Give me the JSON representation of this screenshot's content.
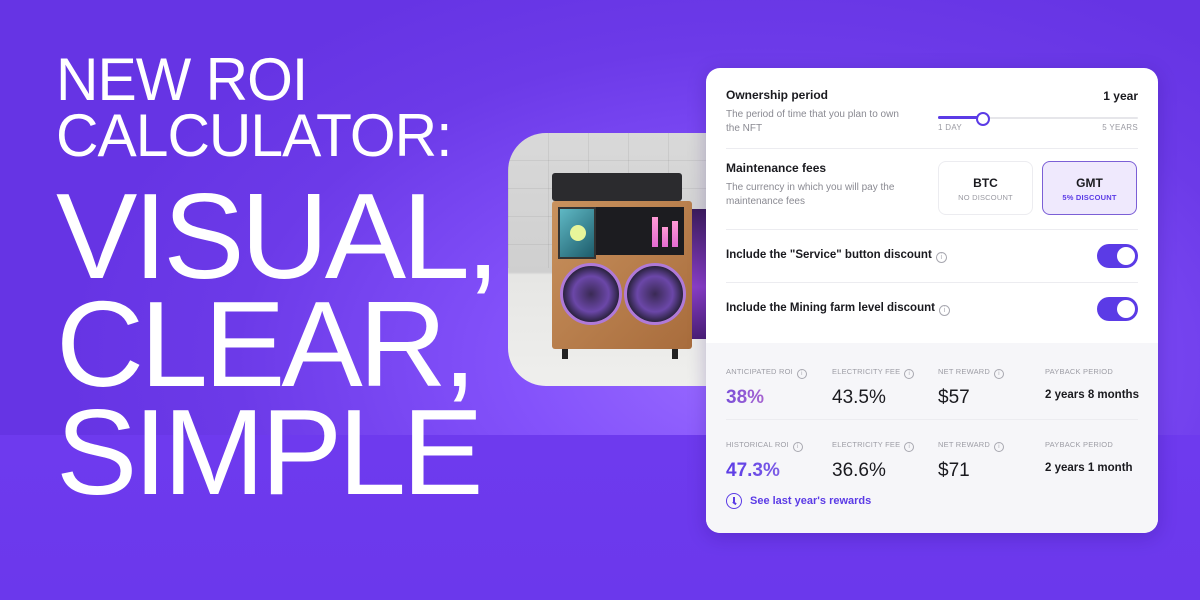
{
  "headline": {
    "line1": "NEW ROI",
    "line2": "CALCULATOR:",
    "line3": "VISUAL,",
    "line4": "CLEAR,",
    "line5": "SIMPLE"
  },
  "image": {
    "alt": "Crypto mining rig NFT"
  },
  "calculator": {
    "ownership": {
      "title": "Ownership period",
      "description": "The period of time that you plan to own the NFT",
      "value_label": "1 year",
      "slider_min_label": "1 DAY",
      "slider_max_label": "5 YEARS",
      "slider_fraction": 0.22
    },
    "maintenance": {
      "title": "Maintenance fees",
      "description": "The currency in which you will pay the maintenance fees",
      "options": [
        {
          "name": "BTC",
          "sub": "NO DISCOUNT",
          "selected": false
        },
        {
          "name": "GMT",
          "sub": "5% DISCOUNT",
          "selected": true
        }
      ]
    },
    "toggles": [
      {
        "label": "Include the \"Service\" button discount",
        "on": true
      },
      {
        "label": "Include the Mining farm level discount",
        "on": true
      }
    ],
    "anticipated": {
      "roi_label": "ANTICIPATED ROI",
      "roi_value": "38%",
      "fee_label": "ELECTRICITY FEE",
      "fee_value": "43.5%",
      "reward_label": "NET REWARD",
      "reward_value": "$57",
      "payback_label": "PAYBACK PERIOD",
      "payback_value": "2 years 8 months"
    },
    "historical": {
      "roi_label": "HISTORICAL ROI",
      "roi_value": "47.3%",
      "fee_label": "ELECTRICITY FEE",
      "fee_value": "36.6%",
      "reward_label": "NET REWARD",
      "reward_value": "$71",
      "payback_label": "PAYBACK PERIOD",
      "payback_value": "2 years 1 month"
    },
    "rewards_link": "See last year's rewards",
    "info_glyph": "i"
  },
  "colors": {
    "accent": "#5b3be6",
    "background": "#6a36e8",
    "selected_option_bg": "#efe9fd"
  }
}
